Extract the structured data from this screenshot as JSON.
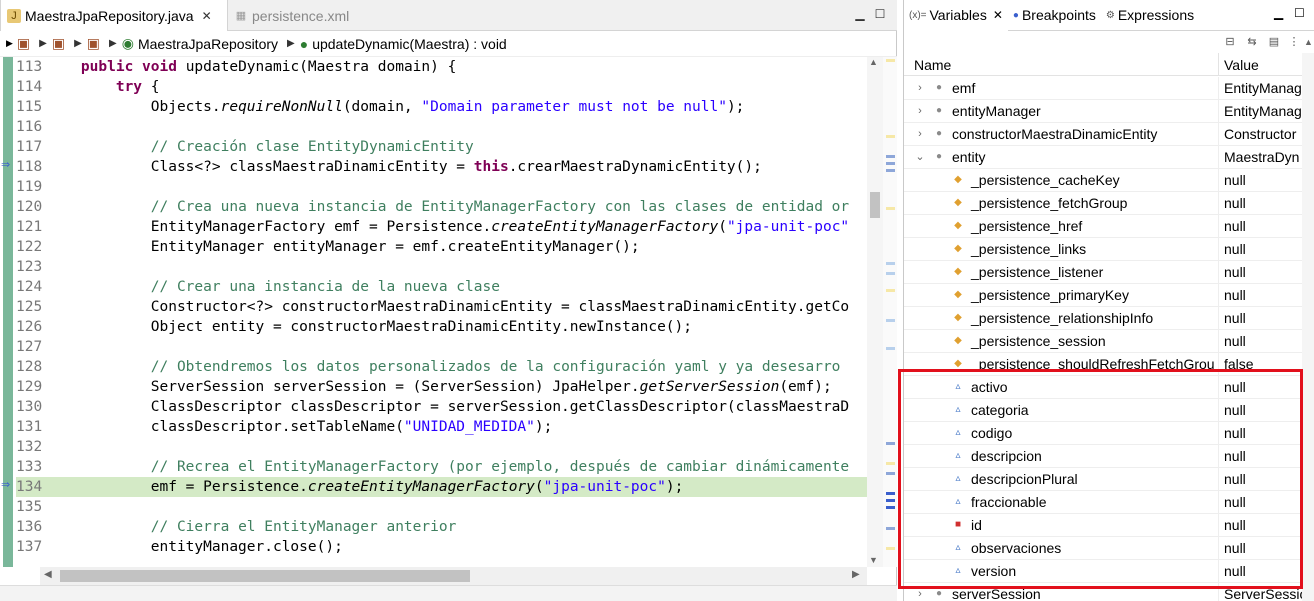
{
  "editor": {
    "tabs": [
      {
        "label": "MaestraJpaRepository.java",
        "active": true
      },
      {
        "label": "persistence.xml",
        "active": false
      }
    ],
    "breadcrumb": [
      {
        "label": "MaestraJpaRepository"
      },
      {
        "label": "updateDynamic(Maestra) : void"
      }
    ],
    "lines": [
      {
        "num": "113",
        "code": "    public void updateDynamic(Maestra domain) {"
      },
      {
        "num": "114",
        "code": "        try {"
      },
      {
        "num": "115",
        "code": "            Objects.requireNonNull(domain, \"Domain parameter must not be null\");"
      },
      {
        "num": "116",
        "code": ""
      },
      {
        "num": "117",
        "code": "            // Creación clase EntityDynamicEntity"
      },
      {
        "num": "118",
        "code": "            Class<?> classMaestraDinamicEntity = this.crearMaestraDynamicEntity();"
      },
      {
        "num": "119",
        "code": ""
      },
      {
        "num": "120",
        "code": "            // Crea una nueva instancia de EntityManagerFactory con las clases de entidad or"
      },
      {
        "num": "121",
        "code": "            EntityManagerFactory emf = Persistence.createEntityManagerFactory(\"jpa-unit-poc\""
      },
      {
        "num": "122",
        "code": "            EntityManager entityManager = emf.createEntityManager();"
      },
      {
        "num": "123",
        "code": ""
      },
      {
        "num": "124",
        "code": "            // Crear una instancia de la nueva clase"
      },
      {
        "num": "125",
        "code": "            Constructor<?> constructorMaestraDinamicEntity = classMaestraDinamicEntity.getCo"
      },
      {
        "num": "126",
        "code": "            Object entity = constructorMaestraDinamicEntity.newInstance();"
      },
      {
        "num": "127",
        "code": ""
      },
      {
        "num": "128",
        "code": "            // Obtendremos los datos personalizados de la configuración yaml y ya desesarro"
      },
      {
        "num": "129",
        "code": "            ServerSession serverSession = (ServerSession) JpaHelper.getServerSession(emf);"
      },
      {
        "num": "130",
        "code": "            ClassDescriptor classDescriptor = serverSession.getClassDescriptor(classMaestraD"
      },
      {
        "num": "131",
        "code": "            classDescriptor.setTableName(\"UNIDAD_MEDIDA\");"
      },
      {
        "num": "132",
        "code": ""
      },
      {
        "num": "133",
        "code": "            // Recrea el EntityManagerFactory (por ejemplo, después de cambiar dinámicamente"
      },
      {
        "num": "134",
        "code": "            emf = Persistence.createEntityManagerFactory(\"jpa-unit-poc\");"
      },
      {
        "num": "135",
        "code": ""
      },
      {
        "num": "136",
        "code": "            // Cierra el EntityManager anterior"
      },
      {
        "num": "137",
        "code": "            entityManager.close();"
      }
    ]
  },
  "variables": {
    "tabs": [
      {
        "label": "Variables",
        "icon": "(x)=",
        "active": true
      },
      {
        "label": "Breakpoints",
        "icon": "breakpoint-icon"
      },
      {
        "label": "Expressions",
        "icon": "expressions-icon"
      }
    ],
    "columns": {
      "name": "Name",
      "value": "Value"
    },
    "rows": [
      {
        "name": "emf",
        "value": "EntityManag",
        "depth": 0,
        "twisty": ">",
        "kind": "field"
      },
      {
        "name": "entityManager",
        "value": "EntityManag",
        "depth": 0,
        "twisty": ">",
        "kind": "field"
      },
      {
        "name": "constructorMaestraDinamicEntity",
        "value": "Constructor",
        "depth": 0,
        "twisty": ">",
        "kind": "field"
      },
      {
        "name": "entity",
        "value": "MaestraDyn",
        "depth": 0,
        "twisty": "v",
        "kind": "field"
      },
      {
        "name": "_persistence_cacheKey",
        "value": "null",
        "depth": 1,
        "twisty": "",
        "kind": "protected"
      },
      {
        "name": "_persistence_fetchGroup",
        "value": "null",
        "depth": 1,
        "twisty": "",
        "kind": "protected"
      },
      {
        "name": "_persistence_href",
        "value": "null",
        "depth": 1,
        "twisty": "",
        "kind": "protected"
      },
      {
        "name": "_persistence_links",
        "value": "null",
        "depth": 1,
        "twisty": "",
        "kind": "protected"
      },
      {
        "name": "_persistence_listener",
        "value": "null",
        "depth": 1,
        "twisty": "",
        "kind": "protected"
      },
      {
        "name": "_persistence_primaryKey",
        "value": "null",
        "depth": 1,
        "twisty": "",
        "kind": "protected"
      },
      {
        "name": "_persistence_relationshipInfo",
        "value": "null",
        "depth": 1,
        "twisty": "",
        "kind": "protected"
      },
      {
        "name": "_persistence_session",
        "value": "null",
        "depth": 1,
        "twisty": "",
        "kind": "protected"
      },
      {
        "name": "_persistence_shouldRefreshFetchGrou",
        "value": "false",
        "depth": 1,
        "twisty": "",
        "kind": "protected"
      },
      {
        "name": "activo",
        "value": "null",
        "depth": 1,
        "twisty": "",
        "kind": "package"
      },
      {
        "name": "categoria",
        "value": "null",
        "depth": 1,
        "twisty": "",
        "kind": "package"
      },
      {
        "name": "codigo",
        "value": "null",
        "depth": 1,
        "twisty": "",
        "kind": "package"
      },
      {
        "name": "descripcion",
        "value": "null",
        "depth": 1,
        "twisty": "",
        "kind": "package"
      },
      {
        "name": "descripcionPlural",
        "value": "null",
        "depth": 1,
        "twisty": "",
        "kind": "package"
      },
      {
        "name": "fraccionable",
        "value": "null",
        "depth": 1,
        "twisty": "",
        "kind": "package"
      },
      {
        "name": "id",
        "value": "null",
        "depth": 1,
        "twisty": "",
        "kind": "private"
      },
      {
        "name": "observaciones",
        "value": "null",
        "depth": 1,
        "twisty": "",
        "kind": "package"
      },
      {
        "name": "version",
        "value": "null",
        "depth": 1,
        "twisty": "",
        "kind": "package"
      },
      {
        "name": "serverSession",
        "value": "ServerSessio",
        "depth": 0,
        "twisty": ">",
        "kind": "field"
      }
    ]
  },
  "colors": {
    "keyword": "#7f0055",
    "comment": "#3f7f5f",
    "string": "#2a00ff",
    "highlight_line": "#d4eac6",
    "annotation_box": "#e2101c"
  }
}
